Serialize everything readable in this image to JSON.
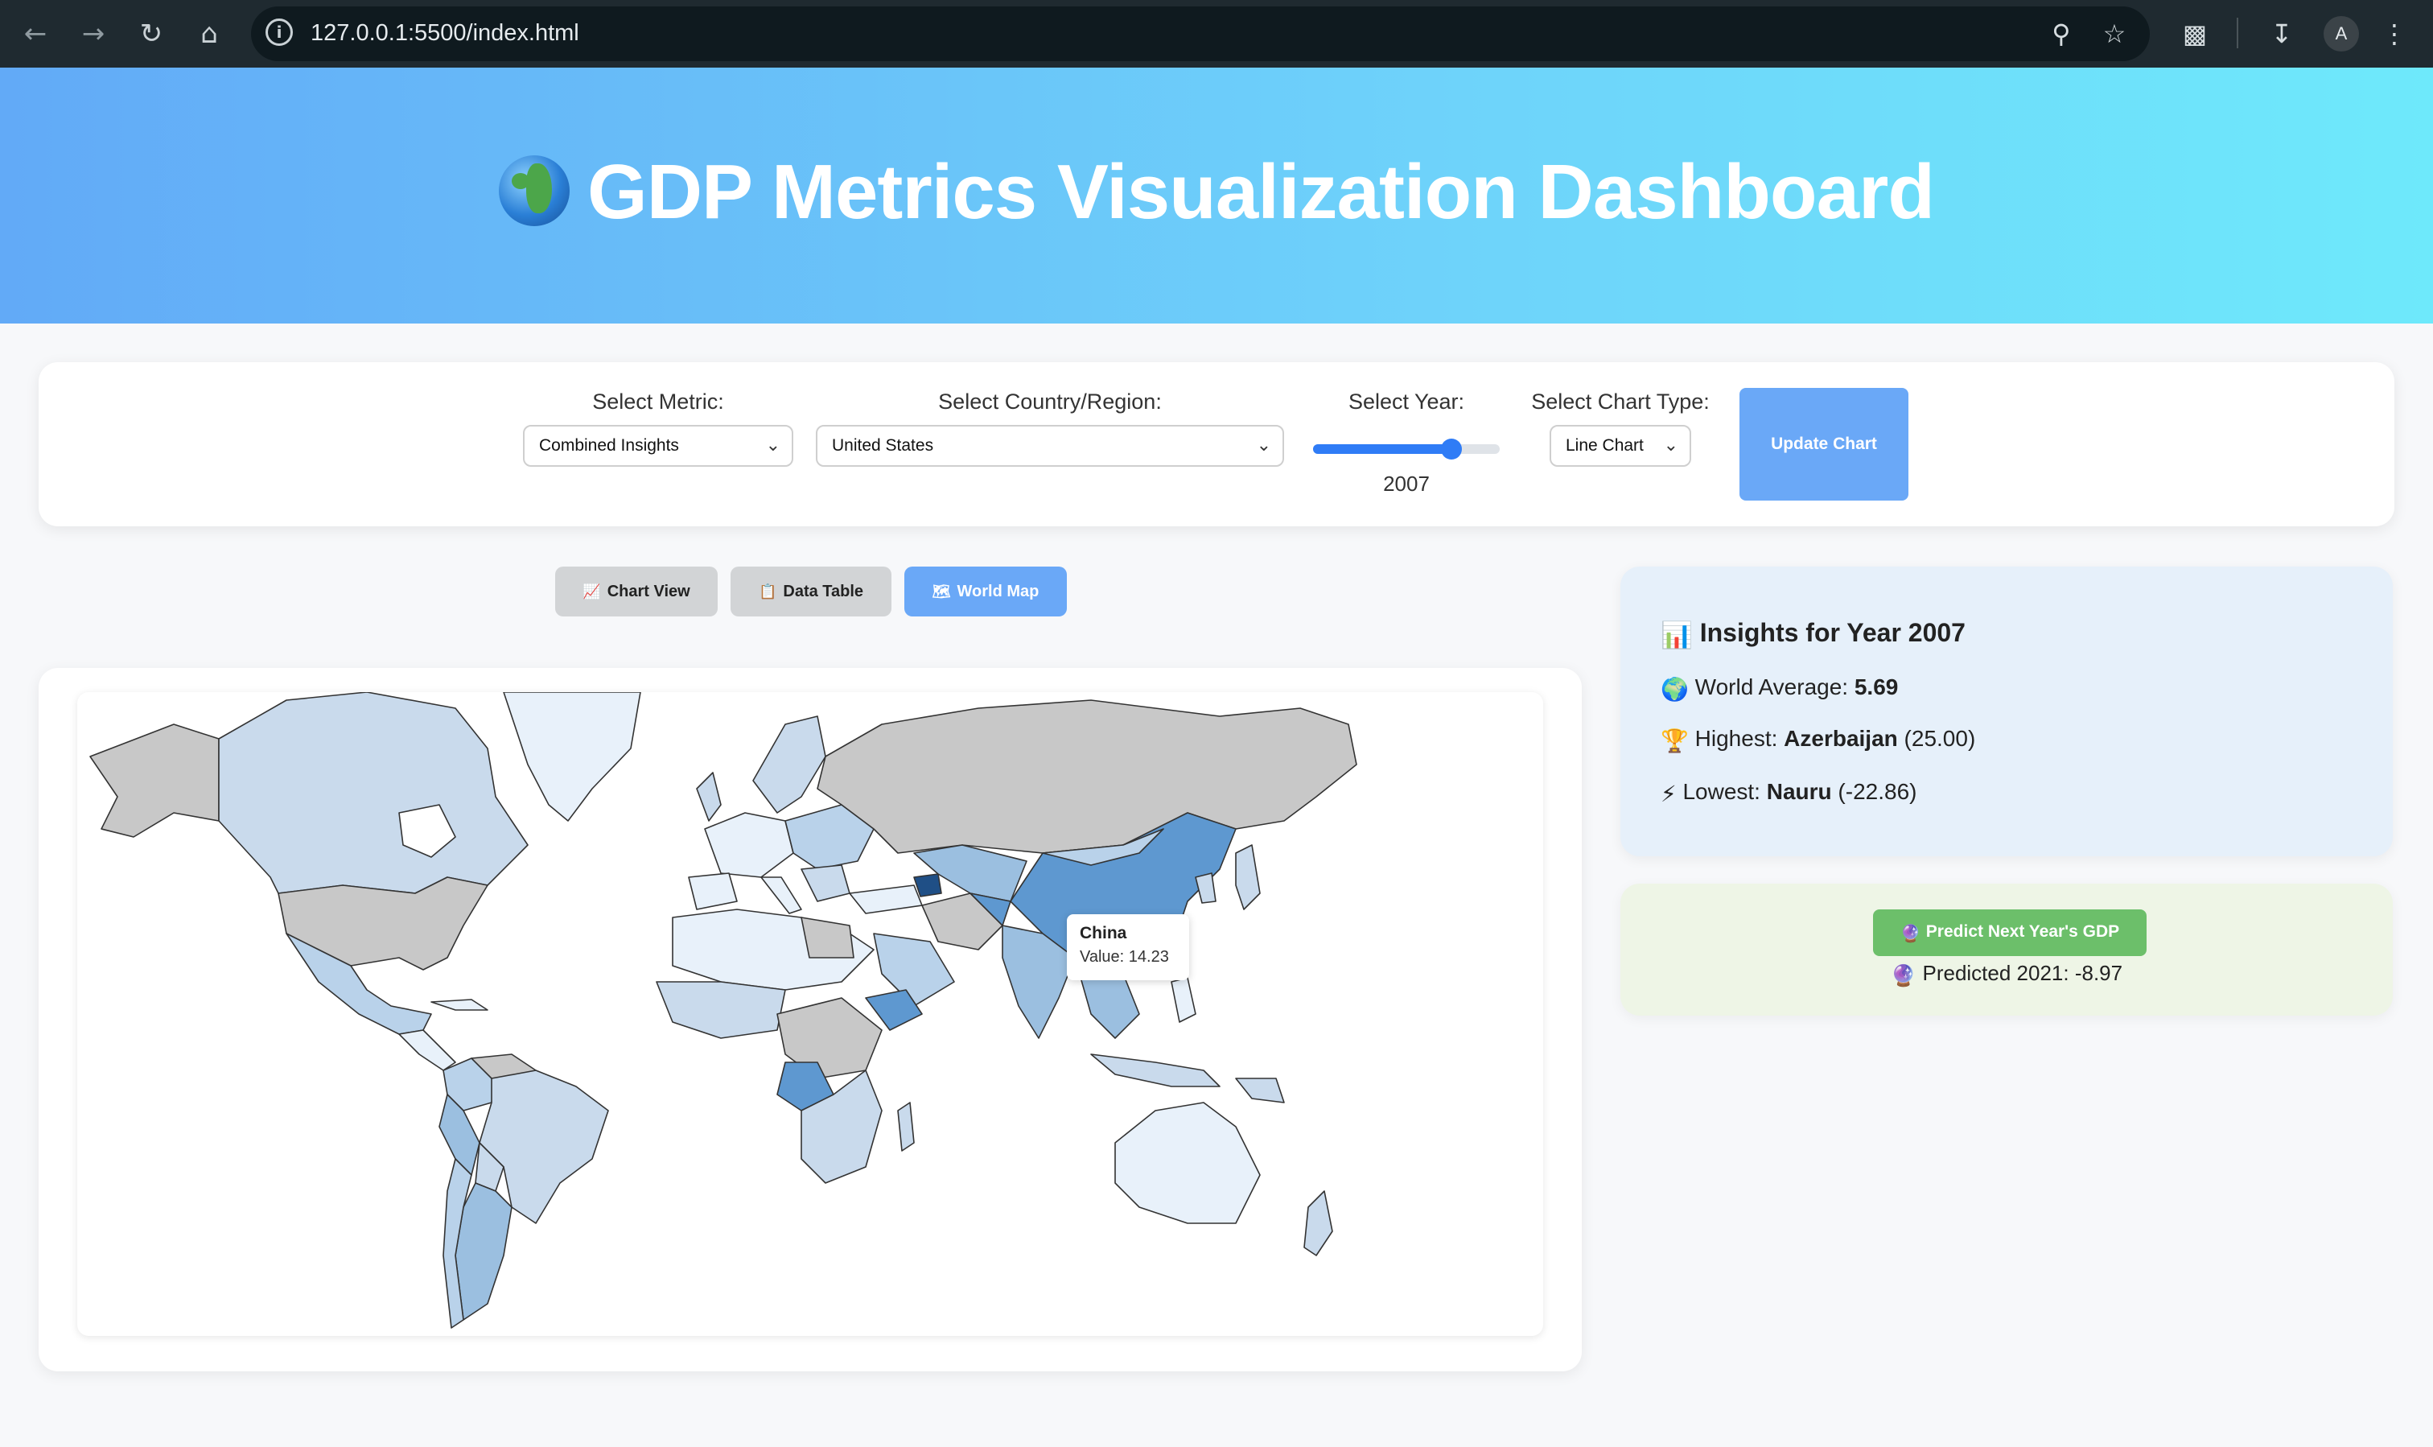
{
  "browser": {
    "url": "127.0.0.1:5500/index.html",
    "avatar_letter": "A"
  },
  "header": {
    "title": "GDP Metrics Visualization Dashboard",
    "title_icon": "globe-emoji"
  },
  "controls": {
    "metric_label": "Select Metric:",
    "metric_value": "Combined Insights",
    "country_label": "Select Country/Region:",
    "country_value": "United States",
    "year_label": "Select Year:",
    "year_value": "2007",
    "year_slider_fraction": 0.74,
    "chart_type_label": "Select Chart Type:",
    "chart_type_value": "Line Chart",
    "update_button": "Update Chart"
  },
  "tabs": [
    {
      "label": "Chart View",
      "icon": "chart-emoji",
      "active": false
    },
    {
      "label": "Data Table",
      "icon": "table-emoji",
      "active": false
    },
    {
      "label": "World Map",
      "icon": "map-emoji",
      "active": true
    }
  ],
  "map": {
    "tooltip": {
      "country": "China",
      "value_text": "Value: 14.23"
    },
    "colors": {
      "no_data": "#c8c8c8",
      "low": "#e8f1fa",
      "mid": "#b9d2ea",
      "high": "#5e98d0",
      "highest": "#1f4f86"
    }
  },
  "insights": {
    "title": "Insights for Year 2007",
    "world_average_label": "World Average:",
    "world_average_value": "5.69",
    "highest_label": "Highest:",
    "highest_country": "Azerbaijan",
    "highest_value": "(25.00)",
    "lowest_label": "Lowest:",
    "lowest_country": "Nauru",
    "lowest_value": "(-22.86)"
  },
  "prediction": {
    "button": "Predict Next Year's GDP",
    "result": "Predicted 2021: -8.97"
  }
}
